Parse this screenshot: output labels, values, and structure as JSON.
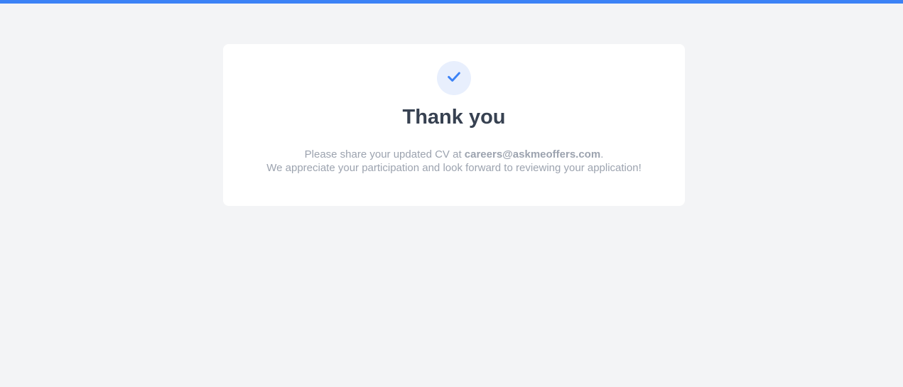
{
  "colors": {
    "accent": "#3b82f6",
    "background": "#f3f4f6",
    "card": "#ffffff",
    "heading": "#374151",
    "muted_text": "#9ca3af",
    "icon_circle": "#e8effd"
  },
  "confirmation": {
    "icon": "checkmark-icon",
    "title": "Thank you",
    "line1_prefix": "Please share your updated CV at ",
    "email": "careers@askmeoffers.com",
    "line1_suffix": ".",
    "line2": "We appreciate your participation and look forward to reviewing your application!"
  }
}
